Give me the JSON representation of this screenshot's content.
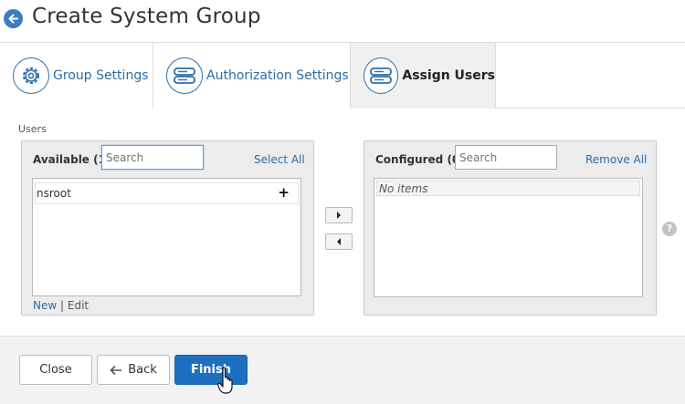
{
  "header": {
    "title": "Create System Group",
    "back_icon": "arrow-left-icon"
  },
  "tabs": [
    {
      "label": "Group Settings",
      "icon": "gear-icon",
      "active": false
    },
    {
      "label": "Authorization Settings",
      "icon": "server-icon",
      "active": false
    },
    {
      "label": "Assign Users",
      "icon": "server-icon",
      "active": true
    }
  ],
  "users": {
    "section_label": "Users",
    "available": {
      "title": "Available (1)",
      "search_placeholder": "Search",
      "action_label": "Select All",
      "items": [
        "nsroot"
      ],
      "new_label": "New",
      "separator": "|",
      "edit_label": "Edit"
    },
    "configured": {
      "title": "Configured (0)",
      "search_placeholder": "Search",
      "action_label": "Remove All",
      "empty_text": "No items"
    },
    "help_glyph": "?"
  },
  "footer": {
    "close_label": "Close",
    "back_label": "Back",
    "finish_label": "Finish"
  },
  "colors": {
    "accent": "#1f6fc0",
    "link": "#2d6ca2",
    "icon_border": "#2f6fab",
    "active_tab_bg": "#f0f0f0"
  }
}
